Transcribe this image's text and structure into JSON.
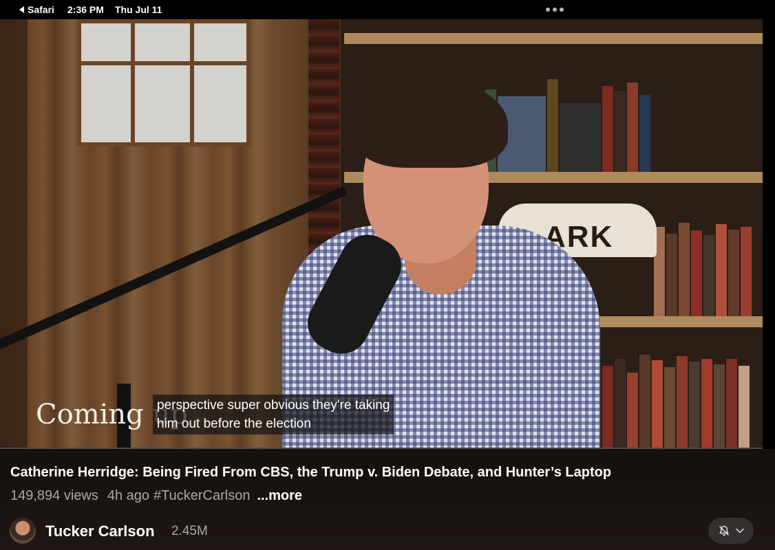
{
  "statusbar": {
    "back_app": "Safari",
    "time": "2:36 PM",
    "date": "Thu Jul 11"
  },
  "video": {
    "overlay_title": "Coming up",
    "caption_line1": "perspective super obvious they're taking",
    "caption_line2": "him out before the election",
    "background_sign_text": "ARK"
  },
  "details": {
    "title": "Catherine Herridge: Being Fired From CBS, the Trump v. Biden Debate, and Hunter’s Laptop",
    "views": "149,894 views",
    "age": "4h ago",
    "hashtag": "#TuckerCarlson",
    "more_label": "...more"
  },
  "channel": {
    "name": "Tucker Carlson",
    "subscribers": "2.45M",
    "notification_icon": "bell-slash-icon",
    "dropdown_icon": "chevron-down-icon"
  },
  "colors": {
    "background": "#000000",
    "info_panel": "#1a1412",
    "text_primary": "#ffffff",
    "text_secondary": "#a9a9a9",
    "button_bg": "#343030"
  }
}
